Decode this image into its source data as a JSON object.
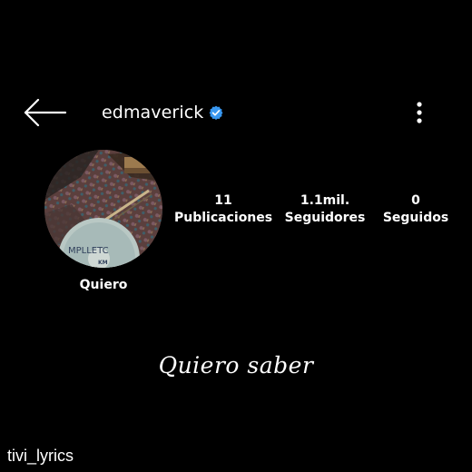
{
  "header": {
    "username": "edmaverick",
    "verified": true,
    "back_icon": "arrow-left-icon",
    "more_icon": "more-vertical-icon",
    "verified_icon": "verified-badge-icon"
  },
  "profile": {
    "name": "Quiero",
    "avatar_description_text": [
      "MPLLETC",
      "KM",
      "ED"
    ]
  },
  "stats": {
    "posts": {
      "count": "11",
      "label": "Publicaciones"
    },
    "followers": {
      "count": "1.1mil.",
      "label": "Seguidores"
    },
    "following": {
      "count": "0",
      "label": "Seguidos"
    }
  },
  "lyric": {
    "text": "Quiero saber"
  },
  "watermark": {
    "text": "tivi_lyrics"
  },
  "colors": {
    "background": "#000000",
    "text": "#ffffff",
    "verified_badge": "#3897f0"
  }
}
